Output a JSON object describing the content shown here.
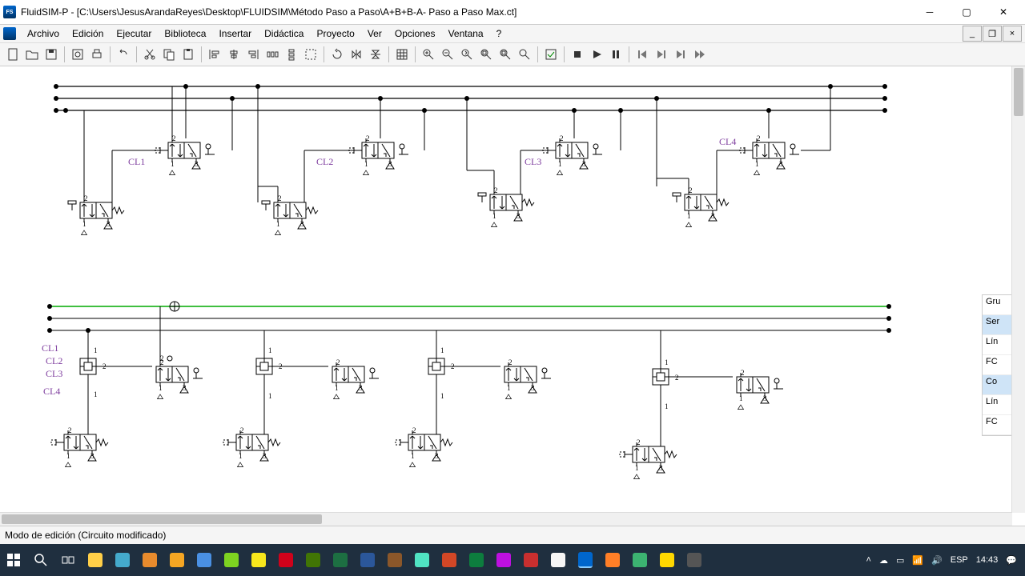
{
  "app": {
    "name": "FluidSIM-P",
    "title": "FluidSIM-P - [C:\\Users\\JesusArandaReyes\\Desktop\\FLUIDSIM\\Método Paso a Paso\\A+B+B-A- Paso a Paso Max.ct]",
    "status": "Modo de edición (Circuito modificado)"
  },
  "menu": [
    "Archivo",
    "Edición",
    "Ejecutar",
    "Biblioteca",
    "Insertar",
    "Didáctica",
    "Proyecto",
    "Ver",
    "Opciones",
    "Ventana",
    "?"
  ],
  "circuit": {
    "top_labels": [
      "CL1",
      "CL2",
      "CL3",
      "CL4"
    ],
    "side_labels": [
      "CL1",
      "CL2",
      "CL3",
      "CL4"
    ]
  },
  "side_panel": {
    "rows": [
      "Gru",
      "Ser",
      "Lín",
      "FC",
      "Co",
      "Lín",
      "FC"
    ],
    "selected": [
      1,
      4
    ]
  },
  "tray": {
    "lang": "ESP",
    "time": "14:43"
  }
}
